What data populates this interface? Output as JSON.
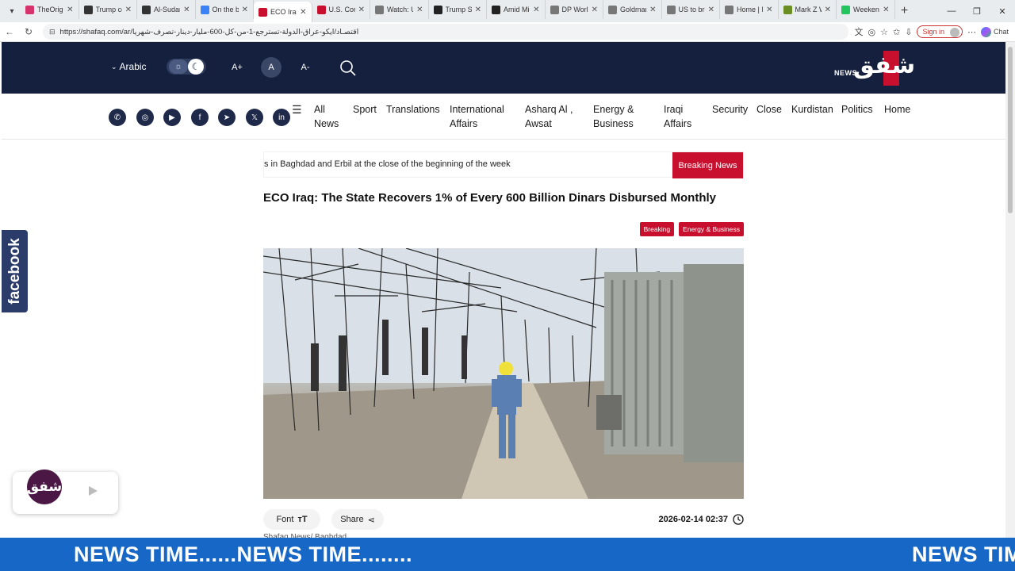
{
  "browser": {
    "tabs": [
      {
        "label": "TheOrigin",
        "color": "#d6336c",
        "active": false
      },
      {
        "label": "Trump cor",
        "color": "#333333",
        "active": false
      },
      {
        "label": "Al-Sudan",
        "color": "#333333",
        "active": false
      },
      {
        "label": "On the bri",
        "color": "#3b82f6",
        "active": false
      },
      {
        "label": "ECO Iraq",
        "color": "#c8102e",
        "active": true
      },
      {
        "label": "U.S. Cong",
        "color": "#c8102e",
        "active": false
      },
      {
        "label": "Watch: Ur",
        "color": "#777777",
        "active": false
      },
      {
        "label": "Trump Say",
        "color": "#222222",
        "active": false
      },
      {
        "label": "Amid Mini",
        "color": "#222222",
        "active": false
      },
      {
        "label": "DP World",
        "color": "#777777",
        "active": false
      },
      {
        "label": "Goldman",
        "color": "#777777",
        "active": false
      },
      {
        "label": "US to brol",
        "color": "#777777",
        "active": false
      },
      {
        "label": "Home | M",
        "color": "#777777",
        "active": false
      },
      {
        "label": "Mark Z W",
        "color": "#6b8e23",
        "active": false
      },
      {
        "label": "Weekend",
        "color": "#22c55e",
        "active": false
      }
    ],
    "url": "https://shafaq.com/ar/اقتصـاد/ايكو-عراق-الدولة-تسترجع-1-من-كل-600-مليار-دينار-تصرف-شهريا",
    "sign_in": "Sign in",
    "chat": "Chat"
  },
  "header": {
    "language": "Arabic",
    "font_plus": "A+",
    "font_reset": "A",
    "font_minus": "A-",
    "logo_text": "NEWS",
    "logo_mark": "شفق"
  },
  "nav": {
    "items": [
      {
        "label": "All News",
        "lines": [
          "All",
          "News"
        ]
      },
      {
        "label": "Sport",
        "lines": [
          "Sport"
        ]
      },
      {
        "label": "Translations",
        "lines": [
          "Translations"
        ]
      },
      {
        "label": "International Affairs",
        "lines": [
          "International",
          "Affairs"
        ]
      },
      {
        "label": "Asharq Al , Awsat",
        "lines": [
          "Asharq Al ,",
          "Awsat"
        ]
      },
      {
        "label": "Energy & Business",
        "lines": [
          "Energy &",
          "Business"
        ]
      },
      {
        "label": "Iraqi Affairs",
        "lines": [
          "Iraqi",
          "Affairs"
        ]
      },
      {
        "label": "Security",
        "lines": [
          "Security"
        ]
      },
      {
        "label": "Close",
        "lines": [
          "Close"
        ]
      },
      {
        "label": "Kurdistan",
        "lines": [
          "Kurdistan"
        ]
      },
      {
        "label": "Politics",
        "lines": [
          "Politics"
        ]
      },
      {
        "label": "Home",
        "lines": [
          "Home"
        ]
      }
    ],
    "social": [
      "whatsapp-icon",
      "instagram-icon",
      "youtube-icon",
      "facebook-icon",
      "telegram-icon",
      "x-icon",
      "linkedin-icon"
    ]
  },
  "breaking": {
    "text": "s in Baghdad and Erbil at the close of the beginning of the week",
    "label": "Breaking News"
  },
  "article": {
    "headline": "ECO Iraq: The State Recovers 1% of Every 600 Billion Dinars Disbursed Monthly",
    "tags": [
      "Breaking",
      "Energy & Business"
    ],
    "font_label": "Font",
    "share_label": "Share",
    "date": "2026-02-14 02:37",
    "byline": "Shafaq News/ Baghdad"
  },
  "sidebar": {
    "facebook": "facebook"
  },
  "ticker": {
    "text": "NEWS TIME......NEWS TIME........",
    "text_repeat": "NEWS TIME"
  },
  "colors": {
    "header_bg": "#14203d",
    "accent_red": "#c8102e",
    "ticker_blue": "#1768c6"
  }
}
